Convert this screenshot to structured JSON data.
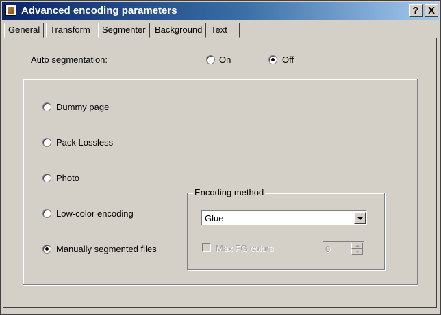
{
  "window": {
    "title": "Advanced encoding parameters",
    "help_button": "?",
    "close_button": "X"
  },
  "tabs": [
    {
      "label": "General",
      "active": false
    },
    {
      "label": "Transform",
      "active": false
    },
    {
      "label": "Segmenter",
      "active": true
    },
    {
      "label": "Background",
      "active": false
    },
    {
      "label": "Text",
      "active": false
    }
  ],
  "auto_segmentation": {
    "label": "Auto segmentation:",
    "options": [
      {
        "label": "On",
        "checked": false
      },
      {
        "label": "Off",
        "checked": true
      }
    ]
  },
  "segmentation_options": [
    {
      "label": "Dummy page",
      "checked": false
    },
    {
      "label": "Pack Lossless",
      "checked": false
    },
    {
      "label": "Photo",
      "checked": false
    },
    {
      "label": "Low-color encoding",
      "checked": false
    },
    {
      "label": "Manually segmented files",
      "checked": true
    }
  ],
  "encoding_method": {
    "legend": "Encoding method",
    "selected": "Glue",
    "max_fg_colors_label": "Max FG colors",
    "max_fg_colors_checked": false,
    "max_fg_colors_value": "0"
  }
}
